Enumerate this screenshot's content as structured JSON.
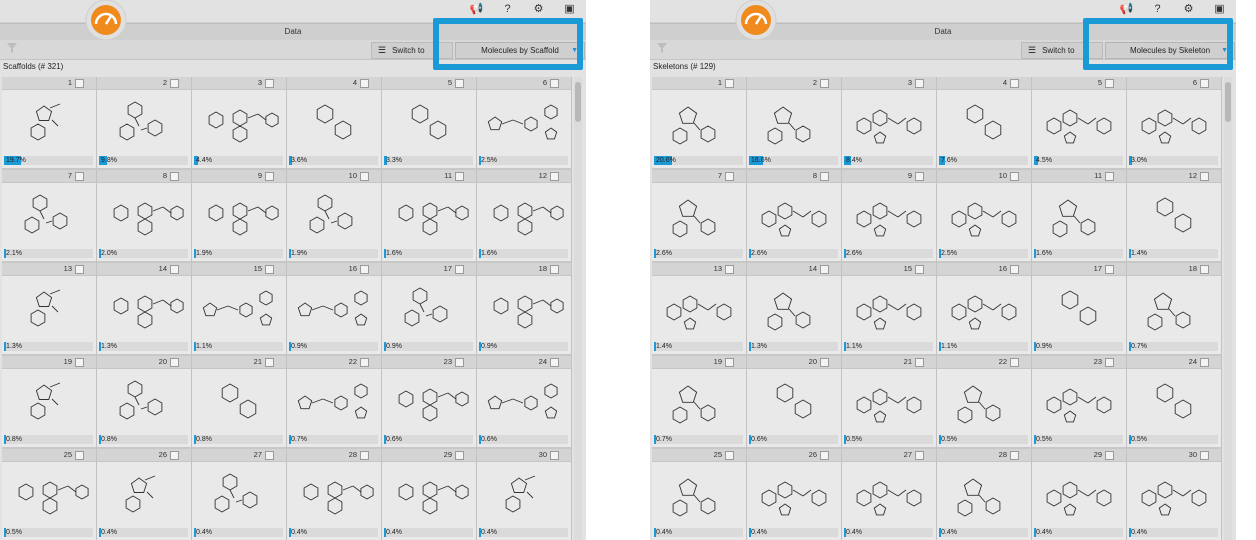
{
  "colors": {
    "accent": "#1a9ad7",
    "logo": "#f08a1c"
  },
  "panels": [
    {
      "tab_title": "Data",
      "switch_label": "Switch to",
      "dropdown_value": "Molecules by Scaffold",
      "list_title": "Scaffolds (# 321)",
      "cells": [
        {
          "n": "1",
          "pct": "19.7%",
          "bar": 0.197,
          "shape": "a"
        },
        {
          "n": "2",
          "pct": "9.8%",
          "bar": 0.098,
          "shape": "b"
        },
        {
          "n": "3",
          "pct": "4.4%",
          "bar": 0.044,
          "shape": "c"
        },
        {
          "n": "4",
          "pct": "3.6%",
          "bar": 0.036,
          "shape": "d"
        },
        {
          "n": "5",
          "pct": "3.3%",
          "bar": 0.033,
          "shape": "d"
        },
        {
          "n": "6",
          "pct": "2.5%",
          "bar": 0.025,
          "shape": "e"
        },
        {
          "n": "7",
          "pct": "2.1%",
          "bar": 0.021,
          "shape": "b"
        },
        {
          "n": "8",
          "pct": "2.0%",
          "bar": 0.02,
          "shape": "c"
        },
        {
          "n": "9",
          "pct": "1.9%",
          "bar": 0.019,
          "shape": "c"
        },
        {
          "n": "10",
          "pct": "1.9%",
          "bar": 0.019,
          "shape": "b"
        },
        {
          "n": "11",
          "pct": "1.6%",
          "bar": 0.016,
          "shape": "c"
        },
        {
          "n": "12",
          "pct": "1.6%",
          "bar": 0.016,
          "shape": "c"
        },
        {
          "n": "13",
          "pct": "1.3%",
          "bar": 0.013,
          "shape": "a"
        },
        {
          "n": "14",
          "pct": "1.3%",
          "bar": 0.013,
          "shape": "c"
        },
        {
          "n": "15",
          "pct": "1.1%",
          "bar": 0.011,
          "shape": "e"
        },
        {
          "n": "16",
          "pct": "0.9%",
          "bar": 0.009,
          "shape": "e"
        },
        {
          "n": "17",
          "pct": "0.9%",
          "bar": 0.009,
          "shape": "b"
        },
        {
          "n": "18",
          "pct": "0.9%",
          "bar": 0.009,
          "shape": "c"
        },
        {
          "n": "19",
          "pct": "0.8%",
          "bar": 0.008,
          "shape": "a"
        },
        {
          "n": "20",
          "pct": "0.8%",
          "bar": 0.008,
          "shape": "b"
        },
        {
          "n": "21",
          "pct": "0.8%",
          "bar": 0.008,
          "shape": "d"
        },
        {
          "n": "22",
          "pct": "0.7%",
          "bar": 0.007,
          "shape": "e"
        },
        {
          "n": "23",
          "pct": "0.6%",
          "bar": 0.006,
          "shape": "c"
        },
        {
          "n": "24",
          "pct": "0.6%",
          "bar": 0.006,
          "shape": "e"
        },
        {
          "n": "25",
          "pct": "0.5%",
          "bar": 0.005,
          "shape": "c"
        },
        {
          "n": "26",
          "pct": "0.4%",
          "bar": 0.004,
          "shape": "a"
        },
        {
          "n": "27",
          "pct": "0.4%",
          "bar": 0.004,
          "shape": "b"
        },
        {
          "n": "28",
          "pct": "0.4%",
          "bar": 0.004,
          "shape": "c"
        },
        {
          "n": "29",
          "pct": "0.4%",
          "bar": 0.004,
          "shape": "c"
        },
        {
          "n": "30",
          "pct": "0.4%",
          "bar": 0.004,
          "shape": "a"
        }
      ]
    },
    {
      "tab_title": "Data",
      "switch_label": "Switch to",
      "dropdown_value": "Molecules by Skeleton",
      "list_title": "Skeletons (# 129)",
      "cells": [
        {
          "n": "1",
          "pct": "20.6%",
          "bar": 0.206,
          "shape": "f"
        },
        {
          "n": "2",
          "pct": "16.6%",
          "bar": 0.166,
          "shape": "f"
        },
        {
          "n": "3",
          "pct": "8.4%",
          "bar": 0.084,
          "shape": "g"
        },
        {
          "n": "4",
          "pct": "7.6%",
          "bar": 0.076,
          "shape": "d"
        },
        {
          "n": "5",
          "pct": "4.5%",
          "bar": 0.045,
          "shape": "g"
        },
        {
          "n": "6",
          "pct": "3.0%",
          "bar": 0.03,
          "shape": "g"
        },
        {
          "n": "7",
          "pct": "2.6%",
          "bar": 0.026,
          "shape": "f"
        },
        {
          "n": "8",
          "pct": "2.6%",
          "bar": 0.026,
          "shape": "g"
        },
        {
          "n": "9",
          "pct": "2.6%",
          "bar": 0.026,
          "shape": "g"
        },
        {
          "n": "10",
          "pct": "2.5%",
          "bar": 0.025,
          "shape": "g"
        },
        {
          "n": "11",
          "pct": "1.6%",
          "bar": 0.016,
          "shape": "f"
        },
        {
          "n": "12",
          "pct": "1.4%",
          "bar": 0.014,
          "shape": "d"
        },
        {
          "n": "13",
          "pct": "1.4%",
          "bar": 0.014,
          "shape": "g"
        },
        {
          "n": "14",
          "pct": "1.3%",
          "bar": 0.013,
          "shape": "f"
        },
        {
          "n": "15",
          "pct": "1.1%",
          "bar": 0.011,
          "shape": "g"
        },
        {
          "n": "16",
          "pct": "1.1%",
          "bar": 0.011,
          "shape": "g"
        },
        {
          "n": "17",
          "pct": "0.9%",
          "bar": 0.009,
          "shape": "d"
        },
        {
          "n": "18",
          "pct": "0.7%",
          "bar": 0.007,
          "shape": "f"
        },
        {
          "n": "19",
          "pct": "0.7%",
          "bar": 0.007,
          "shape": "f"
        },
        {
          "n": "20",
          "pct": "0.6%",
          "bar": 0.006,
          "shape": "d"
        },
        {
          "n": "21",
          "pct": "0.5%",
          "bar": 0.005,
          "shape": "g"
        },
        {
          "n": "22",
          "pct": "0.5%",
          "bar": 0.005,
          "shape": "f"
        },
        {
          "n": "23",
          "pct": "0.5%",
          "bar": 0.005,
          "shape": "g"
        },
        {
          "n": "24",
          "pct": "0.5%",
          "bar": 0.005,
          "shape": "d"
        },
        {
          "n": "25",
          "pct": "0.4%",
          "bar": 0.004,
          "shape": "f"
        },
        {
          "n": "26",
          "pct": "0.4%",
          "bar": 0.004,
          "shape": "g"
        },
        {
          "n": "27",
          "pct": "0.4%",
          "bar": 0.004,
          "shape": "g"
        },
        {
          "n": "28",
          "pct": "0.4%",
          "bar": 0.004,
          "shape": "f"
        },
        {
          "n": "29",
          "pct": "0.4%",
          "bar": 0.004,
          "shape": "g"
        },
        {
          "n": "30",
          "pct": "0.4%",
          "bar": 0.004,
          "shape": "g"
        }
      ]
    }
  ]
}
